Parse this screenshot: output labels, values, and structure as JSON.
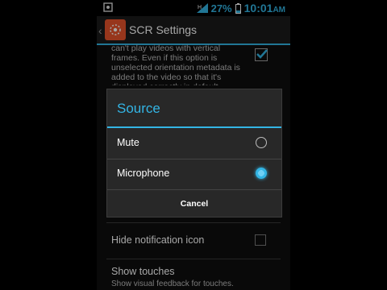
{
  "status_bar": {
    "battery_percent": "27%",
    "time": "10:01",
    "am_pm": "AM",
    "icons": [
      "notification-icon",
      "signal-icon",
      "battery-icon"
    ]
  },
  "action_bar": {
    "title": "SCR Settings",
    "up_glyph": "‹"
  },
  "background": {
    "description": "can't play videos with vertical frames. Even if this option is unselected orientation metadata is added to the video so that it's displayed correctly in default",
    "description_checked": true,
    "items": [
      {
        "title": "Hide notification icon",
        "checked": false
      },
      {
        "title": "Show touches",
        "subtitle": "Show visual feedback for touches."
      }
    ]
  },
  "dialog": {
    "title": "Source",
    "options": [
      {
        "label": "Mute",
        "selected": false
      },
      {
        "label": "Microphone",
        "selected": true
      }
    ],
    "cancel_label": "Cancel"
  },
  "colors": {
    "accent": "#33b5e5",
    "app_icon": "#e8542b",
    "dialog_bg": "#282828"
  }
}
